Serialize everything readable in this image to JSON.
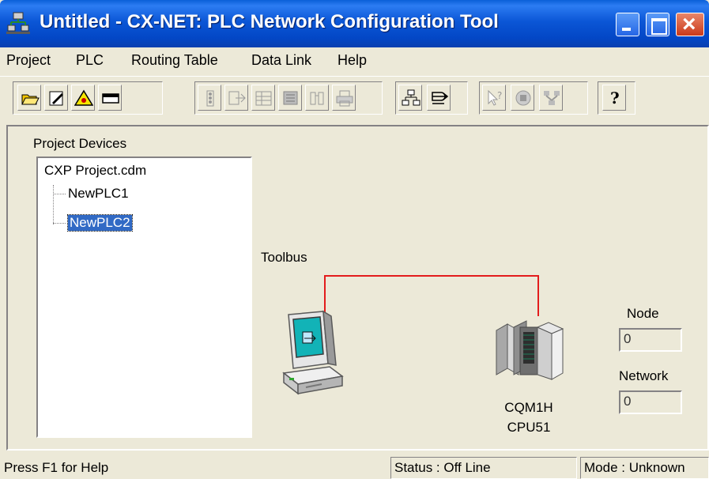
{
  "window": {
    "title": "Untitled - CX-NET: PLC Network Configuration Tool"
  },
  "menu": [
    "Project",
    "PLC",
    "Routing Table",
    "Data Link",
    "Help"
  ],
  "toolbar": {
    "icons": [
      "open-icon",
      "edit-icon",
      "warning-icon",
      "device-icon",
      "plc-io-icon",
      "transfer-icon",
      "table-icon",
      "memory-icon",
      "routing-icon",
      "print-icon",
      "network-tree-icon",
      "datalink-icon",
      "help-cursor-icon",
      "disk-icon",
      "network-icon",
      "help-icon"
    ],
    "help_glyph": "?"
  },
  "project_devices": {
    "label": "Project Devices",
    "root": "CXP Project.cdm",
    "nodes": [
      "NewPLC1",
      "NewPLC2"
    ],
    "selected": "NewPLC2"
  },
  "network": {
    "bus_label": "Toolbus",
    "device_model_line1": "CQM1H",
    "device_model_line2": "CPU51"
  },
  "address": {
    "node_label": "Node",
    "node_value": "0",
    "network_label": "Network",
    "network_value": "0"
  },
  "status": {
    "help": "Press F1 for Help",
    "status": "Status : Off Line",
    "mode": "Mode : Unknown"
  },
  "colors": {
    "titlebar": "#0a5fd8",
    "selection": "#316ac5",
    "bus_wire": "#e31c1c",
    "window_bg": "#ece9d8"
  }
}
